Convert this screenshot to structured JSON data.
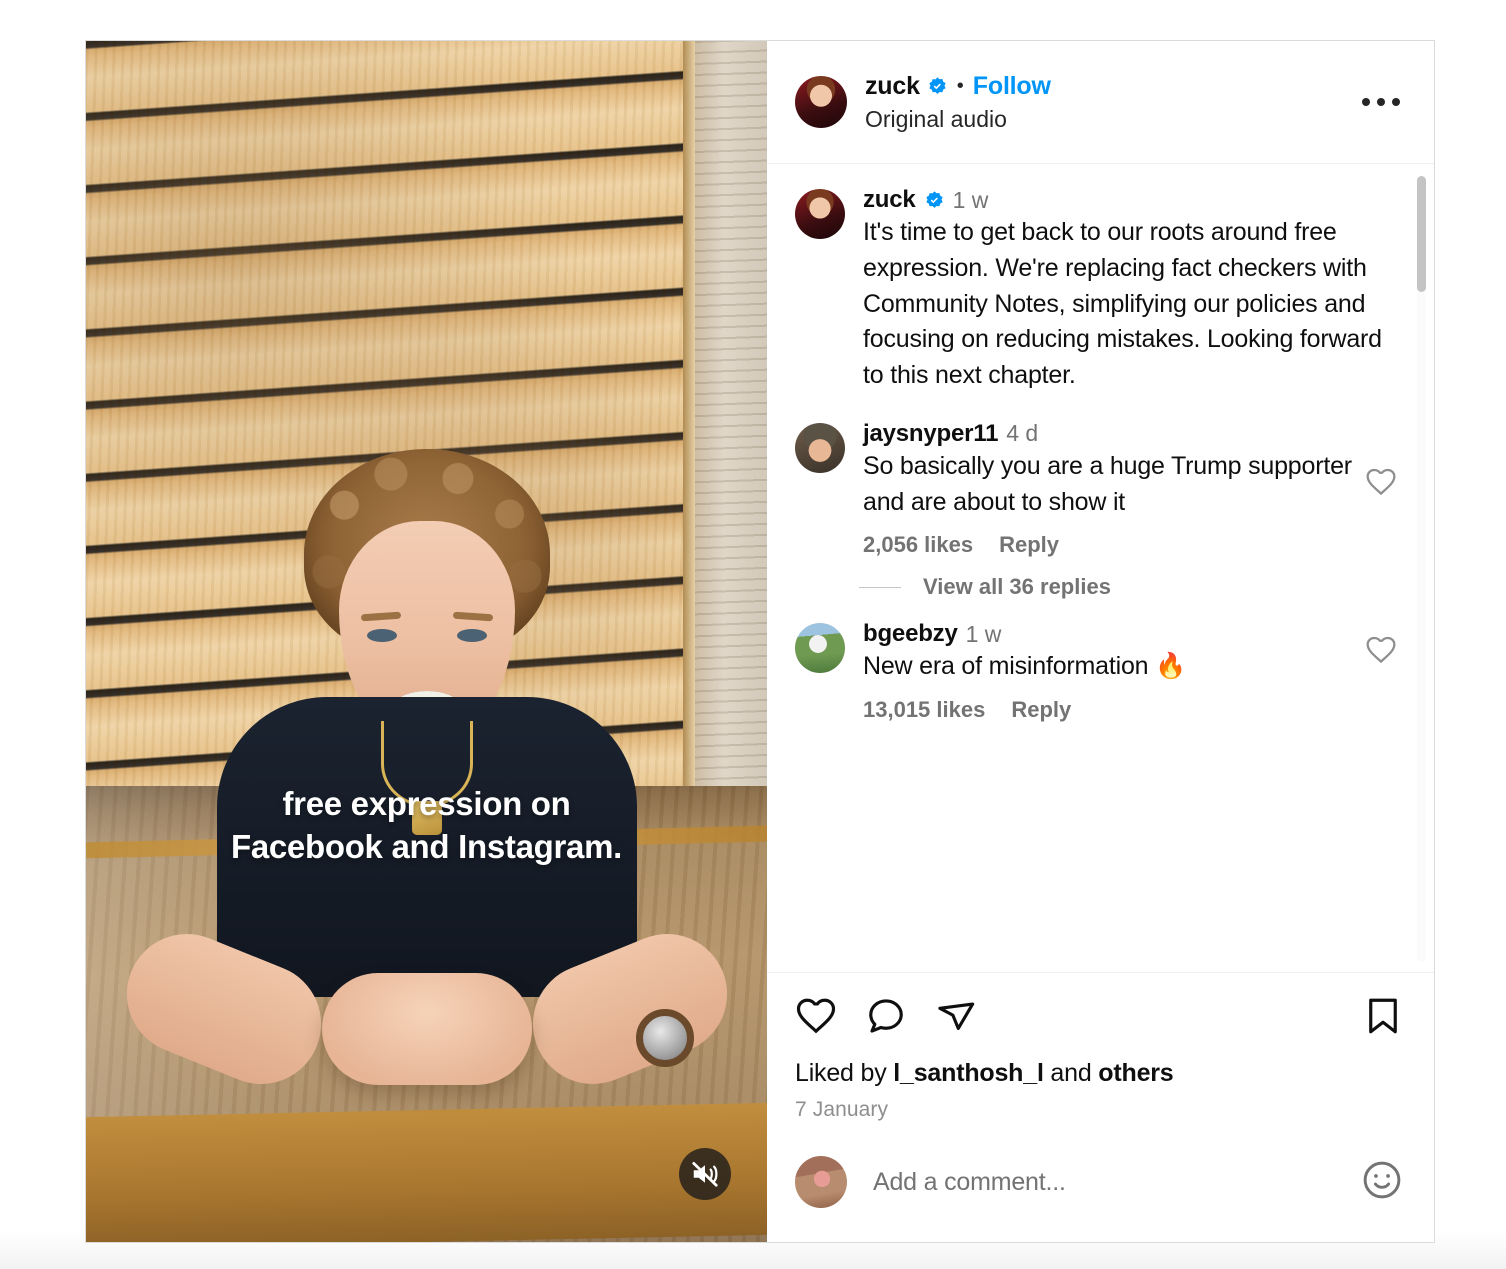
{
  "post": {
    "header": {
      "username": "zuck",
      "verified": true,
      "separator": "•",
      "follow_label": "Follow",
      "audio_label": "Original audio",
      "more_icon": "more-options-icon"
    },
    "media": {
      "caption_line1": "free expression on",
      "caption_line2": "Facebook and Instagram.",
      "mute_icon": "muted-speaker-icon",
      "muted": true
    },
    "caption": {
      "username": "zuck",
      "verified": true,
      "time": "1 w",
      "text": "It's time to get back to our roots around free expression. We're replacing fact checkers with Community Notes, simplifying our policies and focusing on reducing mistakes. Looking forward to this next chapter."
    },
    "comments": [
      {
        "username": "jaysnyper11",
        "time": "4 d",
        "text": "So basically you are a huge Trump supporter and are about to show it",
        "likes": "2,056 likes",
        "reply_label": "Reply",
        "like_icon": "heart-icon",
        "replies_label": "View all 36 replies"
      },
      {
        "username": "bgeebzy",
        "time": "1 w",
        "text": "New era of misinformation 🔥",
        "likes": "13,015 likes",
        "reply_label": "Reply",
        "like_icon": "heart-icon"
      }
    ],
    "actions": {
      "like_icon": "heart-icon",
      "comment_icon": "comment-bubble-icon",
      "share_icon": "share-paper-plane-icon",
      "save_icon": "bookmark-icon"
    },
    "likes_summary": {
      "prefix": "Liked by ",
      "user": "l_santhosh_l",
      "middle": " and ",
      "others": "others"
    },
    "date": "7 January",
    "add_comment": {
      "placeholder": "Add a comment...",
      "value": "",
      "emoji_icon": "smiley-face-icon"
    }
  },
  "colors": {
    "accent_blue": "#0095F6",
    "text_primary": "#0F0F0F",
    "text_secondary": "#737373",
    "border": "#DBDBDB"
  }
}
